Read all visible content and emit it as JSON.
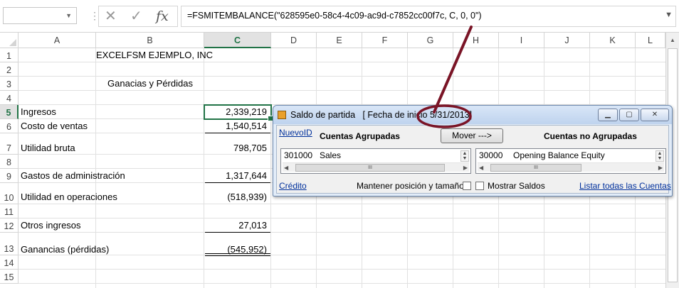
{
  "formula_bar": {
    "name_box": "",
    "cancel_glyph": "✕",
    "enter_glyph": "✓",
    "fx_glyph": "fx",
    "formula": "=FSMITEMBALANCE(\"628595e0-58c4-4c09-ac9d-c7852cc00f7c, C, 0, 0\")"
  },
  "columns": [
    "A",
    "B",
    "C",
    "D",
    "E",
    "F",
    "G",
    "H",
    "I",
    "J",
    "K",
    "L"
  ],
  "selected_column": "C",
  "rows": [
    "1",
    "2",
    "3",
    "4",
    "5",
    "6",
    "7",
    "8",
    "9",
    "10",
    "11",
    "12",
    "13",
    "14",
    "15"
  ],
  "selected_row": "5",
  "cells": {
    "B1": "EXCELFSM EJEMPLO, INC",
    "B3": "Ganacias y Pérdidas",
    "A5": "Ingresos",
    "C5": "2,339,219",
    "A6": "Costo de ventas",
    "C6": "1,540,514",
    "A7": "Utilidad bruta",
    "C7": "798,705",
    "A9": "Gastos de administración",
    "C9": "1,317,644",
    "A10": "Utilidad en operaciones",
    "C10": "(518,939)",
    "A12": "Otros ingresos",
    "C12": "27,013",
    "A13": "Ganancias (pérdidas)",
    "C13": "(545,952)"
  },
  "dialog": {
    "title": "Saldo de partida",
    "title_extra": "[ Fecha de inicio",
    "date": "5/31/2013",
    "date_suffix": "]",
    "nuevo_id": "NuevoID",
    "grouped_label": "Cuentas Agrupadas",
    "move_button": "Mover --->",
    "ungrouped_label": "Cuentas no Agrupadas",
    "left_list": {
      "code": "301000",
      "name": "Sales"
    },
    "right_list": {
      "code": "30000",
      "name": "Opening Balance Equity"
    },
    "credit_link": "Crédito",
    "keep_position_label": "Mantener posición y tamaño",
    "keep_position_checked": false,
    "show_balances_label": "Mostrar Saldos",
    "show_balances_checked": false,
    "list_all_link": "Listar todas las Cuentas"
  },
  "colors": {
    "excel_green": "#217346",
    "annotation": "#7a1426",
    "link": "#00309c"
  }
}
